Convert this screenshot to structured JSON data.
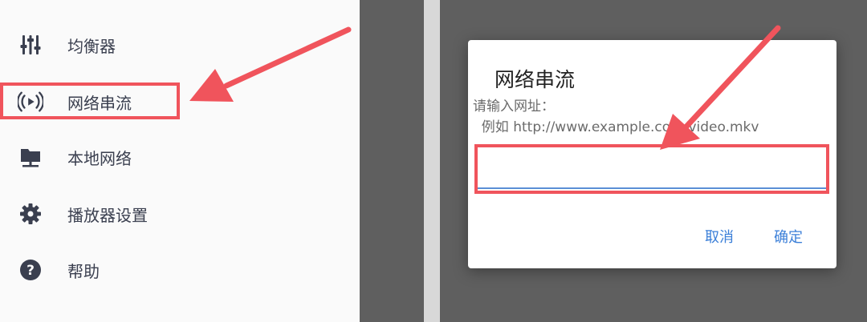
{
  "sidebar": {
    "items": [
      {
        "label": "均衡器",
        "icon": "equalizer-icon"
      },
      {
        "label": "网络串流",
        "icon": "stream-icon"
      },
      {
        "label": "本地网络",
        "icon": "folder-network-icon"
      },
      {
        "label": "播放器设置",
        "icon": "gear-icon"
      },
      {
        "label": "帮助",
        "icon": "help-icon"
      }
    ]
  },
  "dialog": {
    "title": "网络串流",
    "message_line1": "请输入网址：",
    "message_line2": "  例如 http://www.example.com/video.mkv",
    "input_value": "",
    "cancel_label": "取消",
    "ok_label": "确定"
  },
  "colors": {
    "highlight": "#f0545c",
    "accent": "#3b7fd8",
    "overlay": "#5f5f5f",
    "icon": "#3a3f4f"
  }
}
